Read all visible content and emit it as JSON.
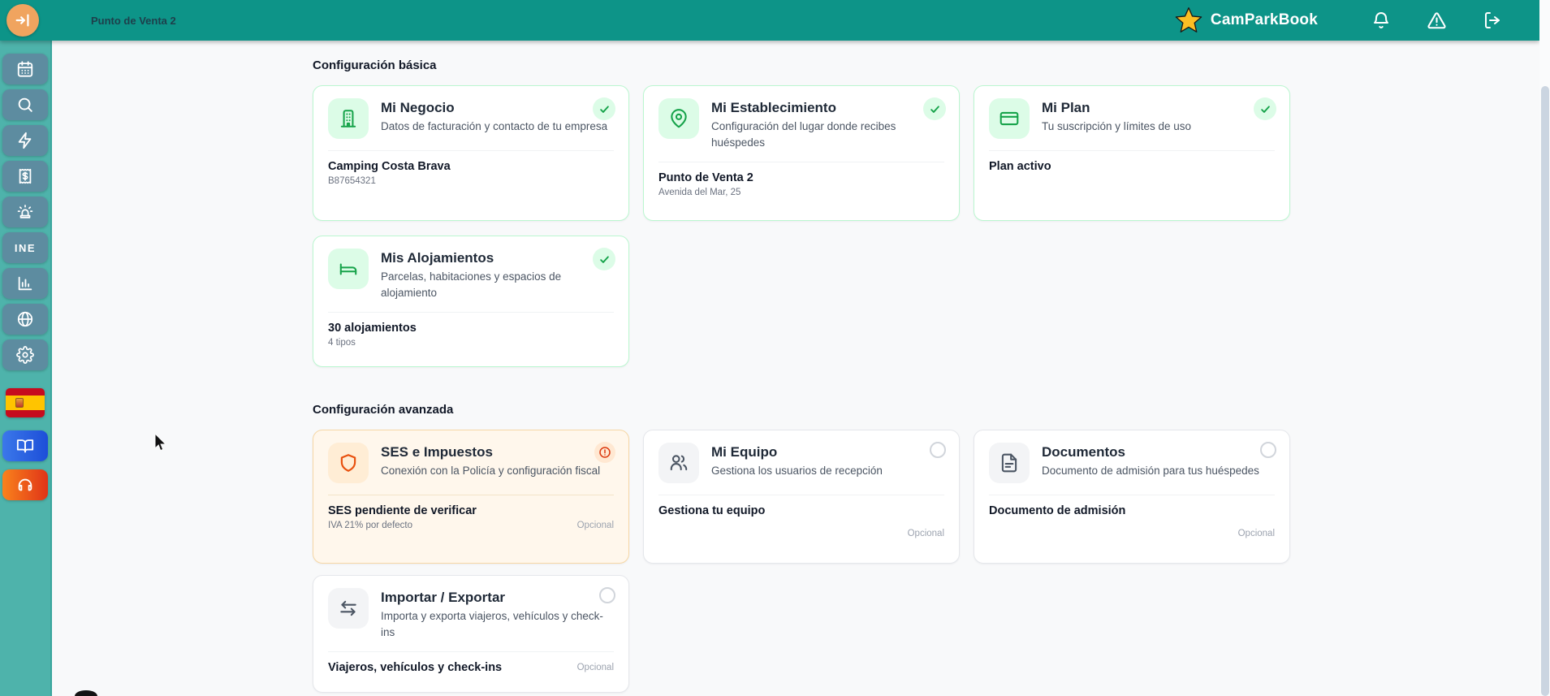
{
  "header": {
    "context": "Punto de Venta 2",
    "brand": "CamParkBook",
    "colors": {
      "bar": "#0d9488",
      "toggle": "#f0a45f",
      "star": "#fbbf24"
    }
  },
  "sidebar": {
    "ine_label": "INE",
    "colors": {
      "bg": "#4eb3ab",
      "button": "#5d8ca0",
      "guide": "#1d4ed8",
      "support": "#e8501c"
    },
    "items": [
      "calendar",
      "search",
      "quick-actions",
      "billing",
      "alarms",
      "ine",
      "statistics",
      "web",
      "settings",
      "language-spanish",
      "guide",
      "support"
    ]
  },
  "sections": {
    "basic": {
      "title": "Configuración básica",
      "cards": {
        "negocio": {
          "title": "Mi Negocio",
          "description": "Datos de facturación y contacto de tu empresa",
          "highlight": "Camping Costa Brava",
          "sub": "B87654321",
          "status": "complete"
        },
        "establecimiento": {
          "title": "Mi Establecimiento",
          "description": "Configuración del lugar donde recibes huéspedes",
          "highlight": "Punto de Venta 2",
          "sub": "Avenida del Mar, 25",
          "status": "complete"
        },
        "plan": {
          "title": "Mi Plan",
          "description": "Tu suscripción y límites de uso",
          "highlight": "Plan activo",
          "status": "complete"
        },
        "alojamientos": {
          "title": "Mis Alojamientos",
          "description": "Parcelas, habitaciones y espacios de alojamiento",
          "highlight": "30 alojamientos",
          "sub": "4 tipos",
          "status": "complete"
        }
      }
    },
    "advanced": {
      "title": "Configuración avanzada",
      "cards": {
        "ses": {
          "title": "SES e Impuestos",
          "description": "Conexión con la Policía y configuración fiscal",
          "highlight": "SES pendiente de verificar",
          "sub": "IVA 21% por defecto",
          "tag": "Opcional",
          "status": "warning"
        },
        "equipo": {
          "title": "Mi Equipo",
          "description": "Gestiona los usuarios de recepción",
          "highlight": "Gestiona tu equipo",
          "tag": "Opcional",
          "status": "pending"
        },
        "documentos": {
          "title": "Documentos",
          "description": "Documento de admisión para tus huéspedes",
          "highlight": "Documento de admisión",
          "tag": "Opcional",
          "status": "pending"
        },
        "importar": {
          "title": "Importar / Exportar",
          "description": "Importa y exporta viajeros, vehículos y check-ins",
          "highlight": "Viajeros, vehículos y check-ins",
          "tag": "Opcional",
          "status": "pending"
        }
      }
    }
  },
  "status_colors": {
    "complete": "#16a34a",
    "warning": "#ea580c",
    "pending": "#d1d5db"
  }
}
